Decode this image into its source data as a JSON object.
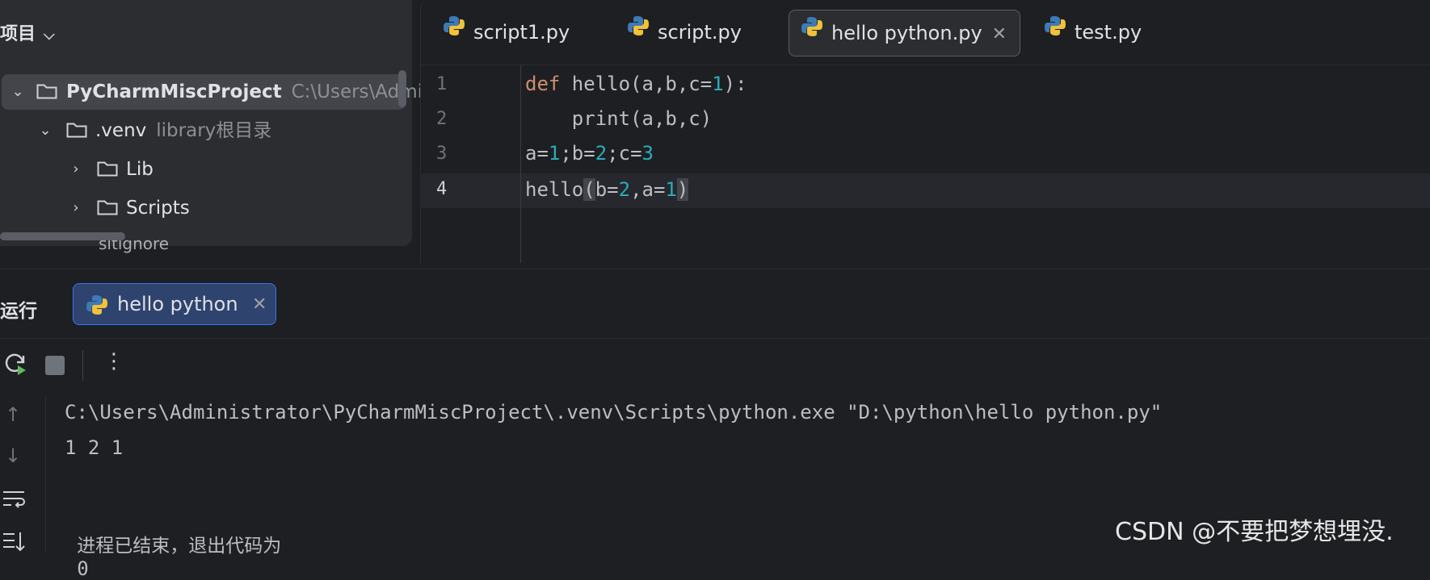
{
  "project": {
    "header": "项目",
    "tree": [
      {
        "label": "PyCharmMiscProject",
        "hint": "C:\\Users\\Admi",
        "expanded": true
      },
      {
        "label": ".venv",
        "hint": "library根目录",
        "expanded": true
      },
      {
        "label": "Lib",
        "hint": "",
        "expanded": false
      },
      {
        "label": "Scripts",
        "hint": "",
        "expanded": false
      }
    ],
    "partial_row": "sitignore"
  },
  "editor": {
    "tabs": [
      {
        "label": "script1.py"
      },
      {
        "label": "script.py"
      },
      {
        "label": "hello python.py",
        "active": true
      },
      {
        "label": "test.py"
      }
    ],
    "line_numbers": [
      "1",
      "2",
      "3",
      "4"
    ],
    "code": [
      {
        "parts": [
          {
            "t": "def",
            "c": "kw"
          },
          {
            "t": " hello(a,b,c="
          },
          {
            "t": "1",
            "c": "num"
          },
          {
            "t": "):"
          }
        ]
      },
      {
        "parts": [
          {
            "t": "    print(a,b,c)"
          }
        ]
      },
      {
        "parts": [
          {
            "t": "a="
          },
          {
            "t": "1",
            "c": "num"
          },
          {
            "t": ";b="
          },
          {
            "t": "2",
            "c": "num"
          },
          {
            "t": ";c="
          },
          {
            "t": "3",
            "c": "num"
          }
        ]
      },
      {
        "parts": [
          {
            "t": "hello"
          },
          {
            "t": "(",
            "c": "paren-hl"
          },
          {
            "t": "b="
          },
          {
            "t": "2",
            "c": "num"
          },
          {
            "t": ",a="
          },
          {
            "t": "1",
            "c": "num"
          },
          {
            "t": ")",
            "c": "paren-hl"
          }
        ]
      }
    ]
  },
  "run": {
    "title": "运行",
    "tab_label": "hello python",
    "console": {
      "command": "C:\\Users\\Administrator\\PyCharmMiscProject\\.venv\\Scripts\\python.exe \"D:\\python\\hello python.py\"",
      "output": "1 2 1",
      "exit_prefix": "进程已结束，退出代码为",
      "exit_code": "0"
    }
  },
  "watermark": "CSDN @不要把梦想埋没.",
  "colors": {
    "background": "#1e1f22",
    "panel": "#2b2d30",
    "keyword": "#cf8e6d",
    "number": "#2aacb8",
    "run_tab_bg": "#2e436e",
    "run_tab_border": "#3574f0"
  }
}
